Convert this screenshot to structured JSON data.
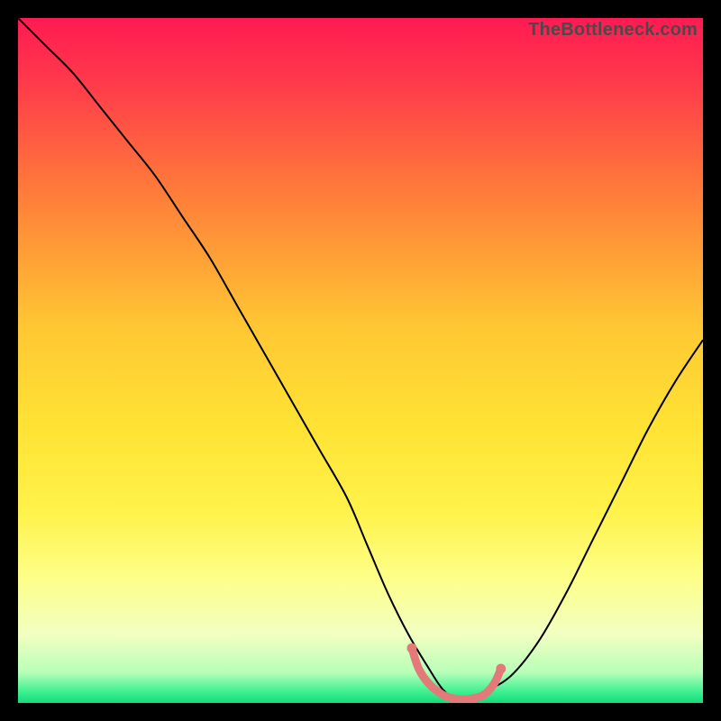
{
  "watermark": "TheBottleneck.com",
  "chart_data": {
    "type": "line",
    "title": "",
    "xlabel": "",
    "ylabel": "",
    "xlim": [
      0,
      100
    ],
    "ylim": [
      0,
      100
    ],
    "grid": false,
    "legend": false,
    "background": {
      "type": "vertical-gradient",
      "stops": [
        {
          "pos": 0.0,
          "color": "#ff1a52"
        },
        {
          "pos": 0.1,
          "color": "#ff3c4a"
        },
        {
          "pos": 0.25,
          "color": "#ff7a3a"
        },
        {
          "pos": 0.45,
          "color": "#ffc733"
        },
        {
          "pos": 0.6,
          "color": "#ffe334"
        },
        {
          "pos": 0.72,
          "color": "#fff24a"
        },
        {
          "pos": 0.82,
          "color": "#fdff8a"
        },
        {
          "pos": 0.9,
          "color": "#f2ffc2"
        },
        {
          "pos": 0.955,
          "color": "#b8ffb8"
        },
        {
          "pos": 0.985,
          "color": "#39ef8f"
        },
        {
          "pos": 1.0,
          "color": "#16d97c"
        }
      ]
    },
    "series": [
      {
        "name": "bottleneck-curve",
        "color": "#000000",
        "stroke_width": 2,
        "x": [
          0,
          4,
          8,
          12,
          16,
          20,
          24,
          28,
          32,
          36,
          40,
          44,
          48,
          51,
          54,
          57,
          60,
          62,
          64,
          66,
          68,
          72,
          76,
          80,
          84,
          88,
          92,
          96,
          100
        ],
        "y": [
          100,
          96,
          92,
          87,
          82,
          77,
          71,
          65,
          58,
          51,
          44,
          37,
          30,
          23,
          16,
          10,
          5,
          2,
          0.5,
          0.5,
          1.5,
          4,
          9,
          16,
          24,
          32,
          40,
          47,
          53
        ]
      }
    ],
    "highlight_segment": {
      "name": "optimal-range-marker",
      "color": "#e37a7a",
      "stroke_width": 9,
      "points_x": [
        57.5,
        58.5,
        60,
        62,
        64,
        66,
        68,
        69.5,
        70.5
      ],
      "points_y": [
        8,
        5,
        2.8,
        1.2,
        0.6,
        0.6,
        1.2,
        2.8,
        5
      ],
      "endpoint_dots": true
    }
  }
}
